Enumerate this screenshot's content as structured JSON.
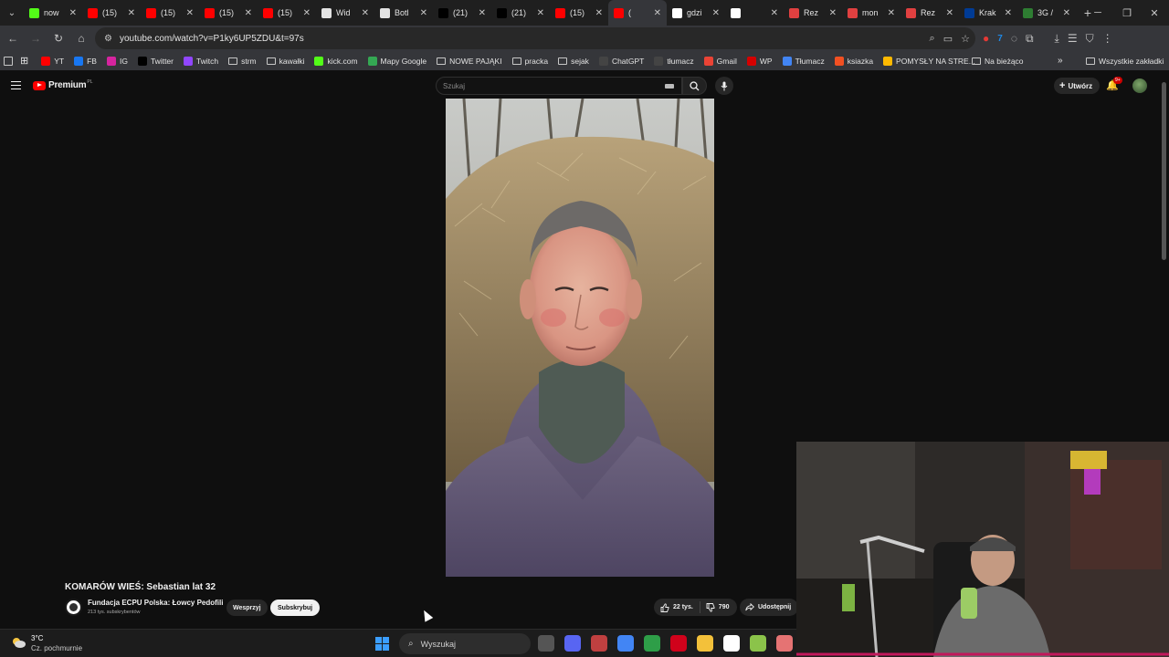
{
  "browser": {
    "tabs": [
      {
        "title": "now",
        "favicon": "kick-icon",
        "color": "#53fc18"
      },
      {
        "title": "(15)",
        "favicon": "youtube-icon",
        "color": "#ff0000"
      },
      {
        "title": "(15)",
        "favicon": "youtube-icon",
        "color": "#ff0000"
      },
      {
        "title": "(15)",
        "favicon": "youtube-icon",
        "color": "#ff0000"
      },
      {
        "title": "(15)",
        "favicon": "youtube-icon",
        "color": "#ff0000"
      },
      {
        "title": "Wid",
        "favicon": "diamond-icon",
        "color": "#e3e3e3"
      },
      {
        "title": "Botl",
        "favicon": "diamond-icon",
        "color": "#e3e3e3"
      },
      {
        "title": "(21)",
        "favicon": "x-icon",
        "color": "#000000"
      },
      {
        "title": "(21)",
        "favicon": "x-icon",
        "color": "#000000"
      },
      {
        "title": "(15)",
        "favicon": "youtube-icon",
        "color": "#ff0000"
      },
      {
        "title": "(",
        "favicon": "youtube-icon",
        "color": "#ff0000",
        "active": true
      },
      {
        "title": "gdzi",
        "favicon": "google-icon",
        "color": "#ffffff"
      },
      {
        "title": "",
        "favicon": "blank-icon",
        "color": "#ffffff"
      },
      {
        "title": "Rez",
        "favicon": "spinner-icon",
        "color": "#e04040"
      },
      {
        "title": "mon",
        "favicon": "spinner-icon",
        "color": "#e04040"
      },
      {
        "title": "Rez",
        "favicon": "spinner-icon",
        "color": "#e04040"
      },
      {
        "title": "Krak",
        "favicon": "booking-icon",
        "color": "#003b95"
      },
      {
        "title": "3G /",
        "favicon": "grid-icon",
        "color": "#2e7d32"
      }
    ],
    "url": "youtube.com/watch?v=P1ky6UP5ZDU&t=97s",
    "bookmarks": [
      {
        "label": "YT",
        "icon": "youtube-icon",
        "color": "#ff0000"
      },
      {
        "label": "FB",
        "icon": "facebook-icon",
        "color": "#1877f2"
      },
      {
        "label": "IG",
        "icon": "instagram-icon",
        "color": "#d6249f"
      },
      {
        "label": "Twitter",
        "icon": "x-icon",
        "color": "#000000"
      },
      {
        "label": "Twitch",
        "icon": "twitch-icon",
        "color": "#9146ff"
      },
      {
        "label": "strm",
        "icon": "folder-icon"
      },
      {
        "label": "kawałki",
        "icon": "folder-icon"
      },
      {
        "label": "kick.com",
        "icon": "kick-icon",
        "color": "#53fc18"
      },
      {
        "label": "Mapy Google",
        "icon": "maps-icon",
        "color": "#34a853"
      },
      {
        "label": "NOWE PAJĄKI",
        "icon": "folder-icon"
      },
      {
        "label": "pracka",
        "icon": "folder-icon"
      },
      {
        "label": "sejak",
        "icon": "folder-icon"
      },
      {
        "label": "ChatGPT",
        "icon": "chatgpt-icon",
        "color": "#444444"
      },
      {
        "label": "tłumacz",
        "icon": "globe-icon",
        "color": "#444444"
      },
      {
        "label": "Gmail",
        "icon": "gmail-icon",
        "color": "#ea4335"
      },
      {
        "label": "WP",
        "icon": "wp-icon",
        "color": "#d50000"
      },
      {
        "label": "Tłumacz",
        "icon": "translate-icon",
        "color": "#4285f4"
      },
      {
        "label": "ksiazka",
        "icon": "microsoft-icon",
        "color": "#f25022"
      },
      {
        "label": "POMYSŁY NA STRE...",
        "icon": "microsoft-icon",
        "color": "#ffb900"
      }
    ],
    "bookmark_folder_right": "Na bieżąco",
    "all_bookmarks": "Wszystkie zakładki"
  },
  "youtube": {
    "brand": "Premium",
    "country": "PL",
    "search_placeholder": "Szukaj",
    "create_label": "Utwórz",
    "notification_count": "9+",
    "video": {
      "title": "KOMARÓW WIEŚ: Sebastian lat 32",
      "channel": "Fundacja ECPU Polska: Łowcy Pedofili",
      "subscribers": "213 tys. subskrybentów",
      "join_label": "Wesprzyj",
      "subscribe_label": "Subskrybuj",
      "likes": "22 tys.",
      "dislikes": "790",
      "share_label": "Udostępnij"
    }
  },
  "taskbar": {
    "temperature": "3°C",
    "weather": "Cz. pochmurnie",
    "search_placeholder": "Wyszukaj",
    "apps": [
      {
        "name": "copilot-icon",
        "color": "#555555"
      },
      {
        "name": "discord-icon",
        "color": "#5865f2"
      },
      {
        "name": "paint-icon",
        "color": "#c04040"
      },
      {
        "name": "chrome-icon",
        "color": "#4285f4"
      },
      {
        "name": "shield-browser-icon",
        "color": "#2e9e48"
      },
      {
        "name": "opera-icon",
        "color": "#d0021b"
      },
      {
        "name": "file-explorer-icon",
        "color": "#f3c13a"
      },
      {
        "name": "notepad-icon",
        "color": "#ffffff"
      },
      {
        "name": "stack-icon",
        "color": "#8bc34a"
      },
      {
        "name": "media-icon",
        "color": "#e57373"
      }
    ]
  }
}
